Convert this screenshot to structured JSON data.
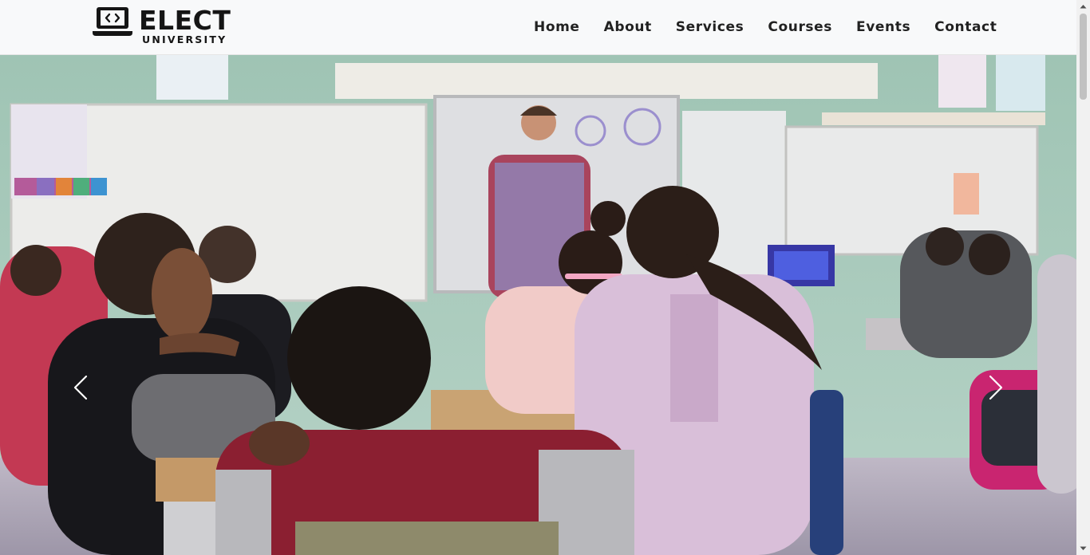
{
  "brand": {
    "name": "ELECT",
    "subtitle": "UNIVERSITY",
    "icon": "laptop-code-icon"
  },
  "nav": {
    "items": [
      {
        "label": "Home"
      },
      {
        "label": "About"
      },
      {
        "label": "Services"
      },
      {
        "label": "Courses"
      },
      {
        "label": "Events"
      },
      {
        "label": "Contact"
      }
    ]
  },
  "carousel": {
    "prev_icon": "chevron-left-icon",
    "next_icon": "chevron-right-icon",
    "slide_image": "classroom-photo"
  },
  "colors": {
    "navbar_bg": "#f8f9fa",
    "text": "#212121",
    "wall": "#a8c9bb"
  }
}
